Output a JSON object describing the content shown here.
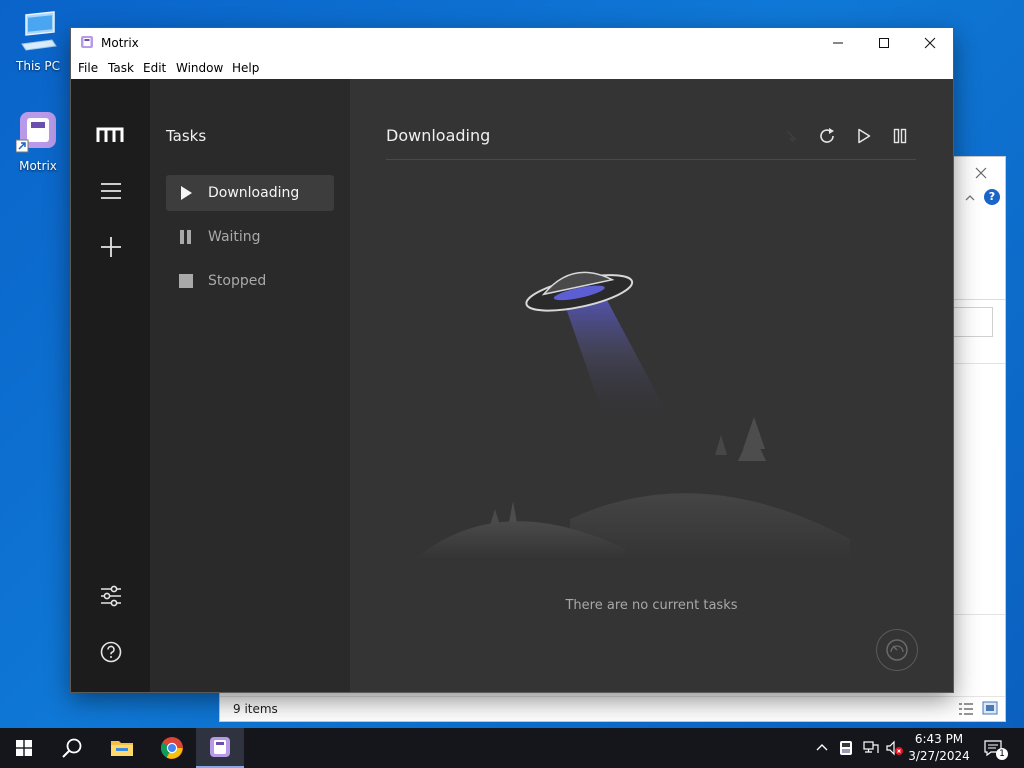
{
  "desktop": {
    "icons": [
      {
        "label": "This PC"
      },
      {
        "label": "Motrix"
      }
    ]
  },
  "explorer": {
    "status": "9 items"
  },
  "window": {
    "title": "Motrix",
    "menu": [
      "File",
      "Task",
      "Edit",
      "Window",
      "Help"
    ]
  },
  "subnav": {
    "title": "Tasks",
    "items": [
      {
        "label": "Downloading",
        "icon": "play-icon",
        "active": true
      },
      {
        "label": "Waiting",
        "icon": "pause-icon",
        "active": false
      },
      {
        "label": "Stopped",
        "icon": "stop-icon",
        "active": false
      }
    ]
  },
  "main": {
    "title": "Downloading",
    "empty_text": "There are no current tasks"
  },
  "taskbar": {
    "time": "6:43 PM",
    "date": "3/27/2024",
    "notification_count": "1"
  },
  "colors": {
    "rail_bg": "#1c1c1c",
    "subnav_bg": "#2a2a2a",
    "main_bg": "#343434",
    "taskbar_bg": "#14161c",
    "ufo_beam": "#5b5bd6"
  }
}
